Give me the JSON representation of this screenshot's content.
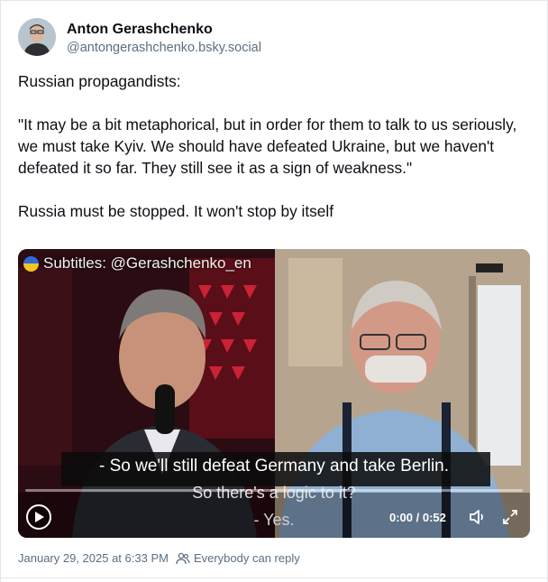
{
  "author": {
    "name": "Anton Gerashchenko",
    "handle": "@antongerashchenko.bsky.social",
    "avatar_icon": "avatar-photo"
  },
  "post": {
    "text": "Russian propagandists:\n\n\"It may be a bit metaphorical, but in order for them to talk to us seriously, we must take Kyiv. We should have defeated Ukraine, but we haven't defeated it so far. They still see it as a sign of weakness.\"\n\nRussia must be stopped. It won't stop by itself"
  },
  "video": {
    "watermark": "Subtitles: @Gerashchenko_en",
    "subtitle_line1": "- So we'll still defeat Germany and take Berlin.",
    "subtitle_line2": "So there's a logic to it?",
    "subtitle_line3": "- Yes.",
    "time": "0:00 / 0:52",
    "progress": 0,
    "play_icon": "play-icon",
    "volume_icon": "volume-icon",
    "fullscreen_icon": "fullscreen-icon"
  },
  "footer": {
    "timestamp": "January 29, 2025 at 6:33 PM",
    "reply_setting": "Everybody can reply",
    "reply_icon": "people-icon"
  }
}
